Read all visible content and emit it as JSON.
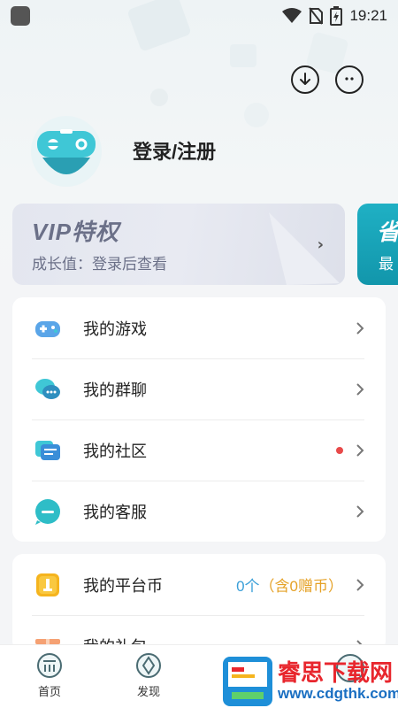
{
  "status_bar": {
    "time": "19:21"
  },
  "profile": {
    "login_label": "登录/注册"
  },
  "vip_card": {
    "title": "VIP特权",
    "subtitle": "成长值：登录后查看",
    "arrow": "›"
  },
  "side_card": {
    "title": "省",
    "subtitle": "最"
  },
  "menu_group_1": [
    {
      "label": "我的游戏",
      "icon": "gamepad-icon",
      "has_dot": false
    },
    {
      "label": "我的群聊",
      "icon": "group-chat-icon",
      "has_dot": false
    },
    {
      "label": "我的社区",
      "icon": "community-icon",
      "has_dot": true
    },
    {
      "label": "我的客服",
      "icon": "customer-service-icon",
      "has_dot": false
    }
  ],
  "menu_group_2": [
    {
      "label": "我的平台币",
      "icon": "coin-icon",
      "value_main": "0个",
      "value_extra": "（含0赠币）"
    },
    {
      "label": "我的礼包",
      "icon": "gift-icon"
    }
  ],
  "bottom_nav": [
    {
      "label": "首页",
      "icon": "home-icon"
    },
    {
      "label": "发现",
      "icon": "discover-icon"
    }
  ],
  "watermark": {
    "title": "睿思下载网",
    "url": "www.cdgthk.com"
  },
  "colors": {
    "accent": "#3a9fd8",
    "coin_extra": "#e5a126",
    "dot": "#e84a4a",
    "teal": "#1fb0c4"
  }
}
